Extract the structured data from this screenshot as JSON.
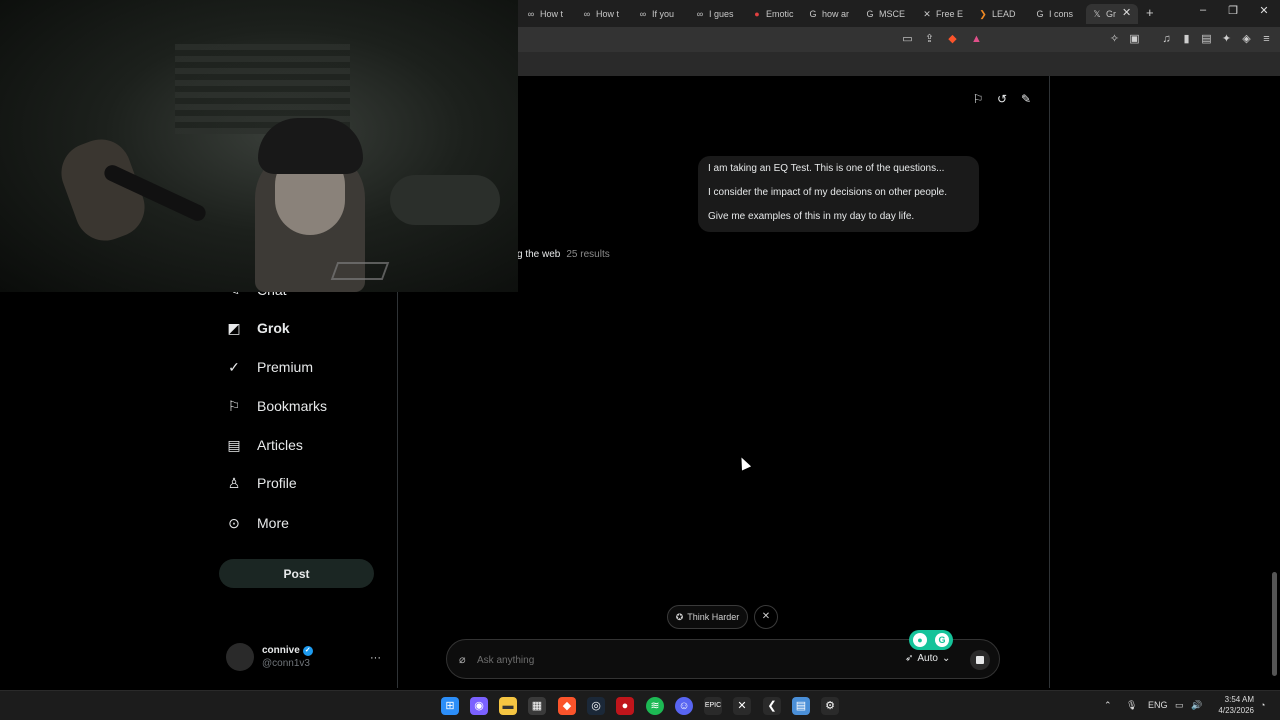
{
  "browser": {
    "tabs": [
      {
        "icon": "infinity",
        "label": "How t"
      },
      {
        "icon": "infinity",
        "label": "How t"
      },
      {
        "icon": "infinity",
        "label": "If you"
      },
      {
        "icon": "infinity",
        "label": "I gues"
      },
      {
        "icon": "record",
        "label": "Emotic"
      },
      {
        "icon": "google",
        "label": "how ar"
      },
      {
        "icon": "google",
        "label": "MSCE"
      },
      {
        "icon": "x-box",
        "label": "Free E"
      },
      {
        "icon": "chevron",
        "label": "LEAD"
      },
      {
        "icon": "google",
        "label": "I cons"
      },
      {
        "icon": "x-logo",
        "label": "Gr"
      }
    ],
    "new_tab": "+",
    "window_controls": [
      "–",
      "❐",
      "✕"
    ]
  },
  "sidebar": {
    "partial_item": "Chat",
    "items": [
      {
        "label": "Grok",
        "icon": "grok-icon",
        "active": true
      },
      {
        "label": "Premium",
        "icon": "premium-icon"
      },
      {
        "label": "Bookmarks",
        "icon": "bookmark-icon"
      },
      {
        "label": "Articles",
        "icon": "articles-icon"
      },
      {
        "label": "Profile",
        "icon": "profile-icon"
      },
      {
        "label": "More",
        "icon": "more-icon"
      }
    ],
    "post_label": "Post",
    "account": {
      "name": "connive",
      "handle": "@conn1v3",
      "more": "···"
    }
  },
  "chat": {
    "user_message": [
      "I am taking an EQ Test. This is one of the questions...",
      "I consider the impact of my decisions on other people.",
      "Give me examples of this in my day to day life."
    ],
    "search_status": "g the web",
    "search_count": "25 results",
    "think_chip": "Think Harder",
    "composer_placeholder": "Ask anything",
    "mode_label": "Auto"
  },
  "taskbar": {
    "language": "ENG",
    "time": "3:54 AM",
    "date": "4/23/2026"
  },
  "colors": {
    "background": "#000000",
    "bubble": "#1a1a1a",
    "verified": "#1d9bf0",
    "grammarly": "#15c39a"
  }
}
